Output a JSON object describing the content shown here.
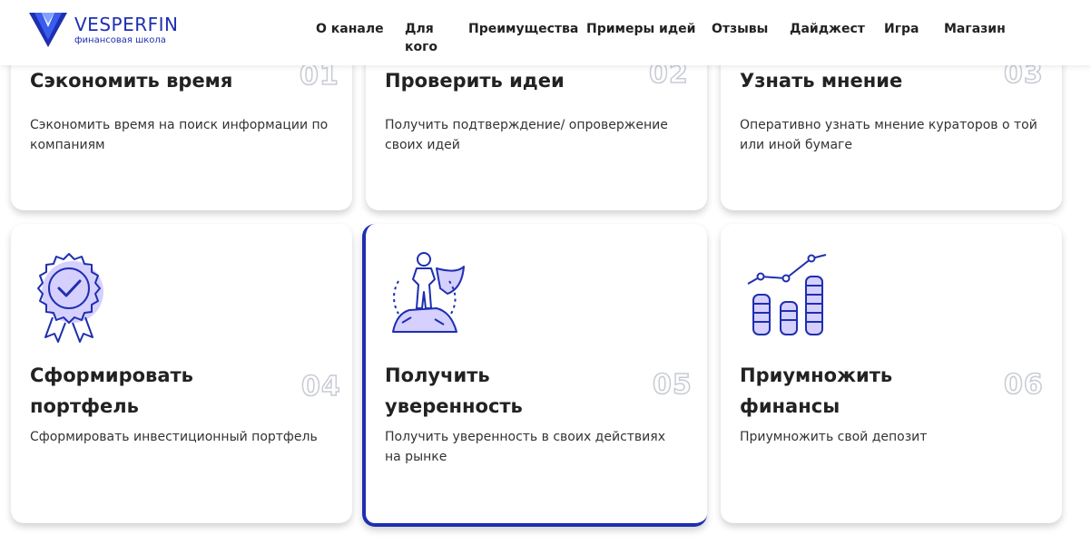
{
  "brand": {
    "name": "VESPERFIN",
    "subtitle": "финансовая школа"
  },
  "nav": [
    "О канале",
    "Для кого",
    "Преимущества",
    "Примеры идей",
    "Отзывы",
    "Дайджест",
    "Игра",
    "Магазин"
  ],
  "cards": [
    {
      "num": "01",
      "title": "Сэкономить время",
      "desc": "Сэкономить время на поиск информации по компаниям"
    },
    {
      "num": "02",
      "title": "Проверить идеи",
      "desc": "Получить подтверждение/ опровержение своих идей"
    },
    {
      "num": "03",
      "title": "Узнать мнение",
      "desc": "Оперативно узнать мнение кураторов о той или иной бумаге"
    },
    {
      "num": "04",
      "title": "Сформировать портфель",
      "desc": "Сформировать инвестиционный портфель",
      "icon": "badge-check-icon"
    },
    {
      "num": "05",
      "title": "Получить уверенность",
      "desc": "Получить уверенность в своих действиях на рынке",
      "icon": "hero-on-rock-icon"
    },
    {
      "num": "06",
      "title": "Приумножить финансы",
      "desc": "Приумножить свой депозит",
      "icon": "coins-growth-icon"
    }
  ],
  "colors": {
    "accent": "#1e2fb0",
    "icon_shadow": "#d6d0ff",
    "number_outline": "#c8cbd4"
  }
}
